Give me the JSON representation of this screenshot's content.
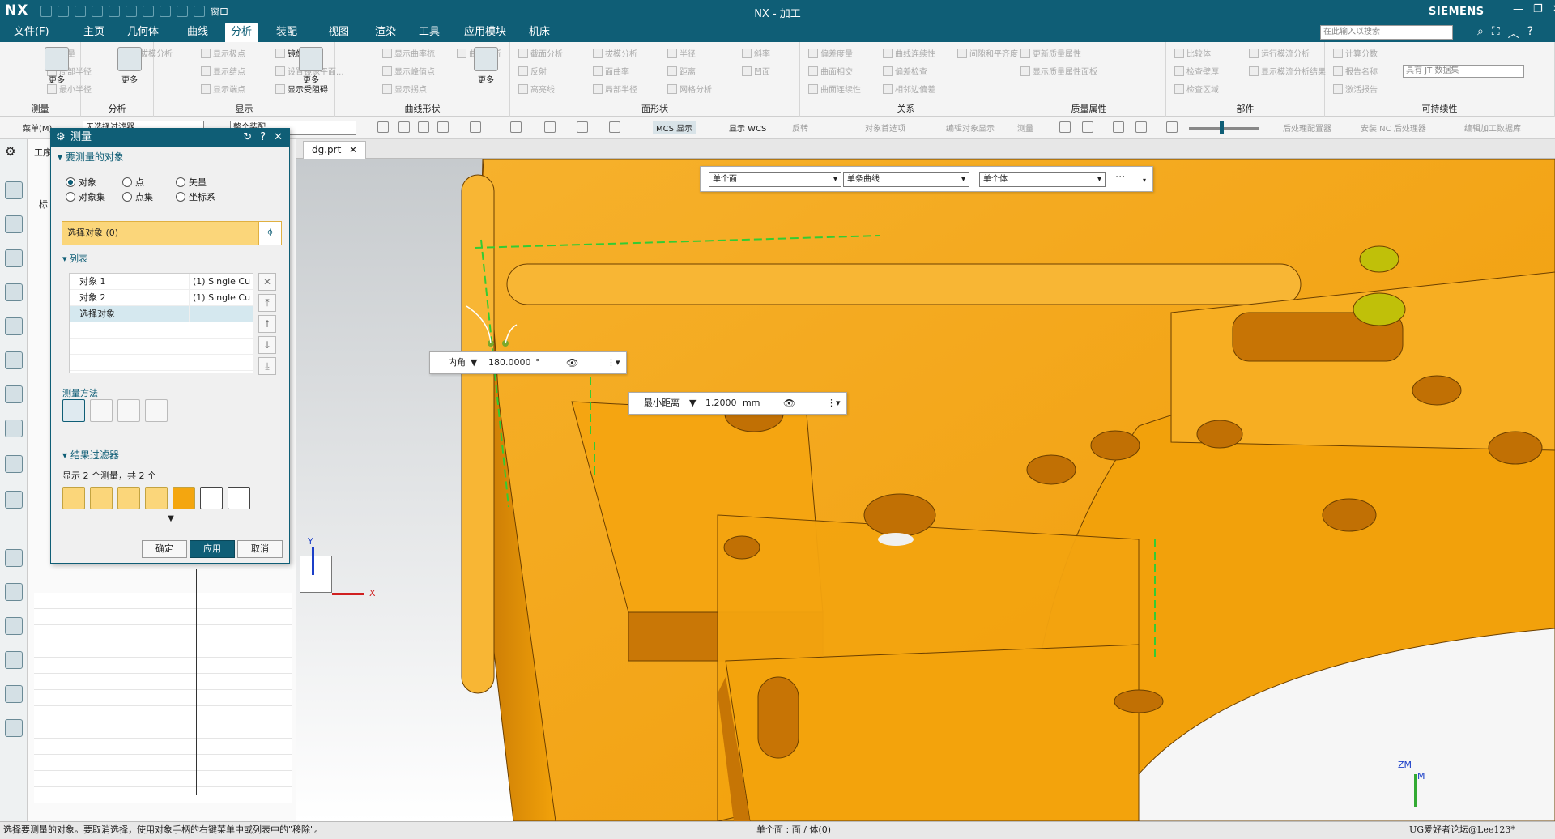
{
  "app": {
    "logo": "NX",
    "title": "NX - 加工",
    "brand": "SIEMENS",
    "window_menu": "窗口"
  },
  "menu": {
    "items": [
      "文件(F)",
      "主页",
      "几何体",
      "曲线",
      "分析",
      "装配",
      "视图",
      "渲染",
      "工具",
      "应用模块",
      "机床"
    ],
    "active_index": 4,
    "search_placeholder": "在此输入以搜索"
  },
  "ribbon": {
    "groups": [
      {
        "label": "测量",
        "items": [
          "测量",
          "局部半径",
          "最小半径"
        ],
        "big": "更多"
      },
      {
        "label": "分析",
        "items": [
          "拔模分析"
        ],
        "big": "更多"
      },
      {
        "label": "显示",
        "items": [
          "显示极点",
          "显示结点",
          "显示端点",
          "镜像显示",
          "设置镜像平面...",
          "显示受阻碍"
        ],
        "big": "更多"
      },
      {
        "label": "曲线形状",
        "items": [
          "显示曲率梳",
          "显示峰值点",
          "显示拐点",
          "曲线分析"
        ],
        "big": "更多"
      },
      {
        "label": "面形状",
        "items": [
          "截面分析",
          "反射",
          "高亮线",
          "拔模分析",
          "面曲率",
          "局部半径",
          "半径",
          "距离",
          "网格分析",
          "斜率",
          "凹面"
        ],
        "big": ""
      },
      {
        "label": "关系",
        "items": [
          "偏差度量",
          "曲面相交",
          "曲面连续性",
          "曲线连续性",
          "偏差检查",
          "相邻边偏差",
          "间隙和平齐度"
        ],
        "big": ""
      },
      {
        "label": "质量属性",
        "items": [
          "更新质量属性",
          "显示质量属性面板"
        ],
        "big": ""
      },
      {
        "label": "部件",
        "items": [
          "比较体",
          "检查壁厚",
          "检查区域",
          "运行模流分析",
          "显示模流分析结果"
        ],
        "big": ""
      },
      {
        "label": "可持续性",
        "items": [
          "计算分数",
          "报告名称",
          "激活报告"
        ],
        "report_value": "具有 JT 数据集"
      }
    ]
  },
  "toolbar2": {
    "menu": "菜单(M)",
    "filter_none": "无选择过滤器",
    "assembly": "整个装配",
    "mcs": "MCS 显示",
    "wcs": "显示 WCS",
    "reverse": "反转",
    "obj_pref": "对象首选项",
    "edit_obj_disp": "编辑对象显示",
    "measure": "测量",
    "post_config": "后处理配置器",
    "install_nc": "安装 NC 后处理器",
    "edit_work": "编辑加工数据库"
  },
  "dialog": {
    "title": "测量",
    "section_objects": "要测量的对象",
    "radios": [
      {
        "label": "对象",
        "checked": true
      },
      {
        "label": "点",
        "checked": false
      },
      {
        "label": "矢量",
        "checked": false
      },
      {
        "label": "对象集",
        "checked": false
      },
      {
        "label": "点集",
        "checked": false
      },
      {
        "label": "坐标系",
        "checked": false
      }
    ],
    "select_label": "选择对象 (0)",
    "list_title": "列表",
    "list": [
      {
        "name": "对象 1",
        "value": "(1) Single Cu"
      },
      {
        "name": "对象 2",
        "value": "(1) Single Cu"
      },
      {
        "name": "选择对象",
        "value": ""
      }
    ],
    "method_title": "测量方法",
    "section_result": "结果过滤器",
    "result_text": "显示 2 个测量，共 2 个",
    "btn_ok": "确定",
    "btn_apply": "应用",
    "btn_cancel": "取消"
  },
  "nav": {
    "header": "工序",
    "col": "标"
  },
  "tabs": {
    "file": "dg.prt"
  },
  "viewport": {
    "filters": [
      "单个面",
      "单条曲线",
      "单个体"
    ],
    "angle": {
      "label": "内角",
      "value": "180.0000",
      "unit": "°"
    },
    "distance": {
      "label": "最小距离",
      "value": "1.2000",
      "unit": "mm"
    },
    "triad_x": "X",
    "triad_y": "Y",
    "triad_zm": "ZM",
    "triad_m": "M"
  },
  "colors": {
    "part": "#f4a60f",
    "accent": "#0f5e76",
    "selection": "#fbd67a"
  },
  "status": {
    "left": "选择要测量的对象。要取消选择，使用对象手柄的右键菜单中或列表中的\"移除\"。",
    "center": "单个面 : 面 / 体(0)",
    "right": "UG爱好者论坛@Lee123*"
  }
}
